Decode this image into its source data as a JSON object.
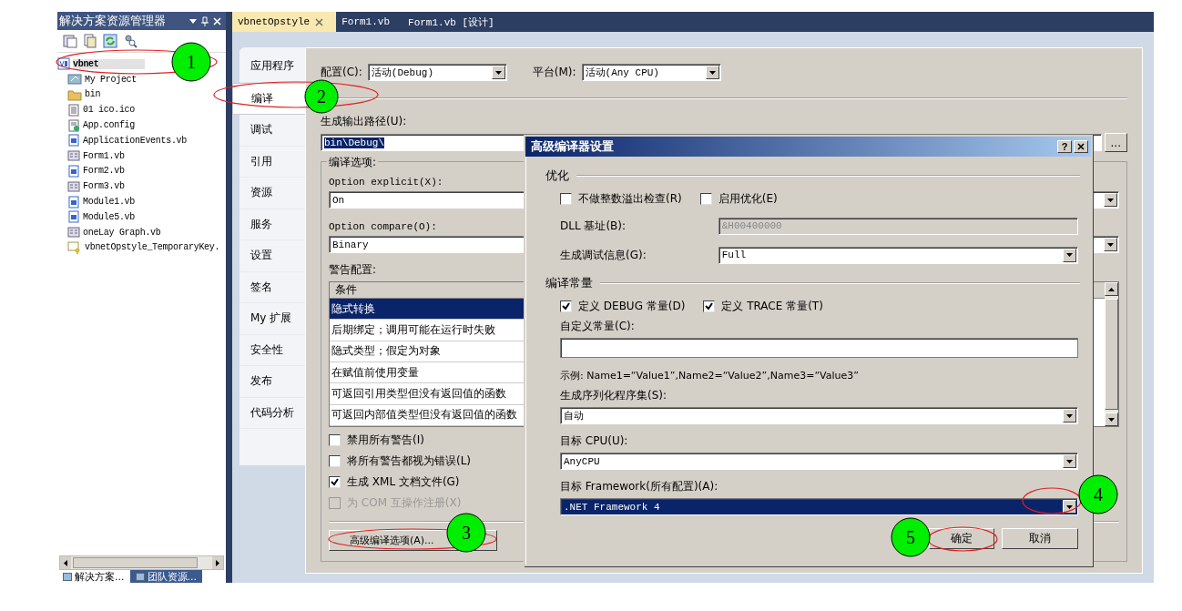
{
  "solution_explorer": {
    "title": "解决方案资源管理器",
    "items": [
      {
        "label": "vbnet",
        "kind": "project",
        "selected": true,
        "children": [
          {
            "label": "My Project",
            "kind": "settings",
            "selected": false
          },
          {
            "label": "bin",
            "kind": "folder",
            "selected": false
          },
          {
            "label": "01 ico.ico",
            "kind": "image",
            "selected": false
          },
          {
            "label": "App.config",
            "kind": "config",
            "selected": false
          },
          {
            "label": "ApplicationEvents.vb",
            "kind": "vb",
            "selected": false
          },
          {
            "label": "Form1.vb",
            "kind": "form",
            "selected": false
          },
          {
            "label": "Form2.vb",
            "kind": "vb",
            "selected": false
          },
          {
            "label": "Form3.vb",
            "kind": "form",
            "selected": false
          },
          {
            "label": "Module1.vb",
            "kind": "vb",
            "selected": false
          },
          {
            "label": "Module5.vb",
            "kind": "vb",
            "selected": false
          },
          {
            "label": "oneLay Graph.vb",
            "kind": "form",
            "selected": false
          },
          {
            "label": "vbnetOpstyle_TemporaryKey.",
            "kind": "key",
            "selected": false
          }
        ]
      }
    ],
    "bottom_tabs": [
      {
        "label": "解决方案...",
        "selected": true
      },
      {
        "label": "团队资源...",
        "selected": false
      }
    ]
  },
  "document_tabs": [
    {
      "label": "vbnetOpstyle",
      "selected": true
    },
    {
      "label": "Form1.vb",
      "selected": false
    },
    {
      "label": "Form1.vb [设计]",
      "selected": false
    }
  ],
  "property_tabs": [
    {
      "label": "应用程序",
      "selected": false
    },
    {
      "label": "编译",
      "selected": true
    },
    {
      "label": "调试",
      "selected": false
    },
    {
      "label": "引用",
      "selected": false
    },
    {
      "label": "资源",
      "selected": false
    },
    {
      "label": "服务",
      "selected": false
    },
    {
      "label": "设置",
      "selected": false
    },
    {
      "label": "签名",
      "selected": false
    },
    {
      "label": "My 扩展",
      "selected": false
    },
    {
      "label": "安全性",
      "selected": false
    },
    {
      "label": "发布",
      "selected": false
    },
    {
      "label": "代码分析",
      "selected": false
    }
  ],
  "compile_page": {
    "config_label": "配置(C):",
    "config_value": "活动(Debug)",
    "platform_label": "平台(M):",
    "platform_value": "活动(Any CPU)",
    "output_path_label": "生成输出路径(U):",
    "output_path": {
      "value": "bin\\Debug\\",
      "value_selected": true
    },
    "browse_button": "...",
    "options_group": "编译选项:",
    "option_explicit_label": "Option explicit(X):",
    "option_explicit_value": "On",
    "option_compare_label": "Option compare(O):",
    "option_compare_value": "Binary",
    "warnings_label": "警告配置:",
    "warnings_table": {
      "columns": [
        "条件"
      ],
      "rows": [
        {
          "condition": "隐式转换",
          "selected": true
        },
        {
          "condition": "后期绑定；调用可能在运行时失败",
          "selected": false
        },
        {
          "condition": "隐式类型；假定为对象",
          "selected": false
        },
        {
          "condition": "在赋值前使用变量",
          "selected": false
        },
        {
          "condition": "可返回引用类型但没有返回值的函数",
          "selected": false
        },
        {
          "condition": "可返回内部值类型但没有返回值的函数",
          "selected": false
        }
      ]
    },
    "checkboxes": [
      {
        "label": "禁用所有警告(I)",
        "checked": false,
        "disabled": false
      },
      {
        "label": "将所有警告都视为错误(L)",
        "checked": false,
        "disabled": false
      },
      {
        "label": "生成 XML 文档文件(G)",
        "checked": true,
        "disabled": false
      },
      {
        "label": "为 COM 互操作注册(X)",
        "checked": false,
        "disabled": true
      }
    ],
    "advanced_button": "高级编译选项(A)..."
  },
  "dialog": {
    "title": "高级编译器设置",
    "help_button": "?",
    "optimization_group": "优化",
    "optimization_checkboxes": [
      {
        "label": "不做整数溢出检查(R)",
        "checked": false
      },
      {
        "label": "启用优化(E)",
        "checked": false
      }
    ],
    "dll_base_label": "DLL 基址(B):",
    "dll_base_value": "&H00400000",
    "debug_info_label": "生成调试信息(G):",
    "debug_info_value": "Full",
    "constants_group": "编译常量",
    "constant_checkboxes": [
      {
        "label": "定义 DEBUG 常量(D)",
        "checked": true
      },
      {
        "label": "定义 TRACE 常量(T)",
        "checked": true
      }
    ],
    "custom_constants_label": "自定义常量(C):",
    "example": "示例: Name1=“Value1”,Name2=“Value2”,Name3=“Value3”",
    "serialization_label": "生成序列化程序集(S):",
    "serialization_value": "自动",
    "target_cpu_label": "目标 CPU(U):",
    "target_cpu_value": "AnyCPU",
    "framework_label": "目标 Framework(所有配置)(A):",
    "framework": {
      "value": ".NET Framework 4",
      "value_selected": true
    },
    "buttons": [
      "确定",
      "取消"
    ]
  },
  "annotations": [
    {
      "number": "1"
    },
    {
      "number": "2"
    },
    {
      "number": "3"
    },
    {
      "number": "4"
    },
    {
      "number": "5"
    }
  ]
}
